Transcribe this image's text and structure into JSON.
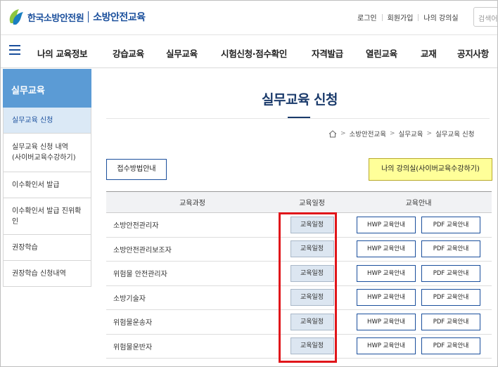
{
  "header": {
    "org_name": "한국소방안전원",
    "site_name": "소방안전교육",
    "util_links": [
      "로그인",
      "회원가입",
      "나의 강의실"
    ],
    "search_placeholder": "검색어"
  },
  "gnb": {
    "items": [
      "나의 교육정보",
      "강습교육",
      "실무교육",
      "시험신청·점수확인",
      "자격발급",
      "열린교육",
      "교재",
      "공지사항"
    ]
  },
  "sidebar": {
    "title": "실무교육",
    "items": [
      {
        "label": "실무교육 신청",
        "active": true
      },
      {
        "label": "실무교육 신청 내역\n(사이버교육수강하기)",
        "active": false
      },
      {
        "label": "이수확인서 발급",
        "active": false
      },
      {
        "label": "이수확인서 발급 진위확인",
        "active": false
      },
      {
        "label": "권장학습",
        "active": false
      },
      {
        "label": "권장학습 신청내역",
        "active": false
      }
    ]
  },
  "main": {
    "title": "실무교육 신청",
    "breadcrumb": [
      "소방안전교육",
      "실무교육",
      "실무교육 신청"
    ],
    "guide_button": "접수방법안내",
    "lecture_button": "나의 강의실(사이버교육수강하기)",
    "table": {
      "headers": [
        "교육과정",
        "교육일정",
        "교육안내"
      ],
      "rows": [
        {
          "course": "소방안전관리자",
          "schedule": "교육일정",
          "hwp": "HWP 교육안내",
          "pdf": "PDF 교육안내"
        },
        {
          "course": "소방안전관리보조자",
          "schedule": "교육일정",
          "hwp": "HWP 교육안내",
          "pdf": "PDF 교육안내"
        },
        {
          "course": "위험물 안전관리자",
          "schedule": "교육일정",
          "hwp": "HWP 교육안내",
          "pdf": "PDF 교육안내"
        },
        {
          "course": "소방기술자",
          "schedule": "교육일정",
          "hwp": "HWP 교육안내",
          "pdf": "PDF 교육안내"
        },
        {
          "course": "위험물운송자",
          "schedule": "교육일정",
          "hwp": "HWP 교육안내",
          "pdf": "PDF 교육안내"
        },
        {
          "course": "위험물운반자",
          "schedule": "교육일정",
          "hwp": "HWP 교육안내",
          "pdf": "PDF 교육안내"
        }
      ]
    }
  },
  "colors": {
    "brand": "#1a4f9c",
    "sidebar_title_bg": "#5b9bd5",
    "sidebar_active_bg": "#dbe9f6",
    "lecture_button_bg": "#ffff99",
    "highlight": "#e0161b"
  }
}
